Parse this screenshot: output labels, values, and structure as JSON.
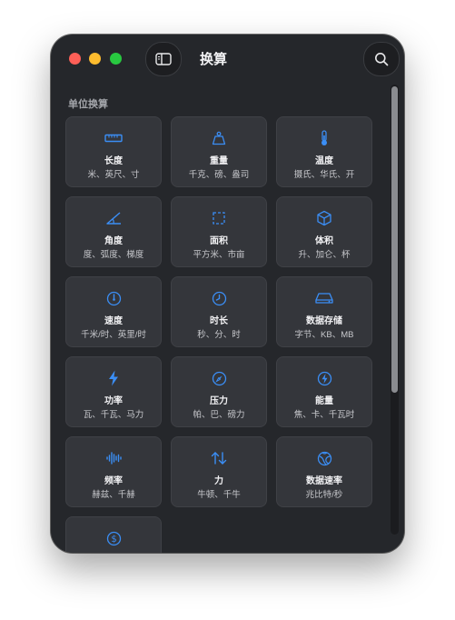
{
  "window": {
    "title": "换算",
    "section_label": "单位换算"
  },
  "units": [
    {
      "name": "长度",
      "examples": "米、英尺、寸",
      "icon": "ruler-icon"
    },
    {
      "name": "重量",
      "examples": "千克、磅、盎司",
      "icon": "weight-icon"
    },
    {
      "name": "温度",
      "examples": "摄氏、华氏、开",
      "icon": "thermometer-icon"
    },
    {
      "name": "角度",
      "examples": "度、弧度、梯度",
      "icon": "angle-icon"
    },
    {
      "name": "面积",
      "examples": "平方米、市亩",
      "icon": "area-icon"
    },
    {
      "name": "体积",
      "examples": "升、加仑、杯",
      "icon": "cube-icon"
    },
    {
      "name": "速度",
      "examples": "千米/时、英里/时",
      "icon": "speedometer-icon"
    },
    {
      "name": "时长",
      "examples": "秒、分、时",
      "icon": "clock-icon"
    },
    {
      "name": "数据存储",
      "examples": "字节、KB、MB",
      "icon": "storage-icon"
    },
    {
      "name": "功率",
      "examples": "瓦、千瓦、马力",
      "icon": "bolt-icon"
    },
    {
      "name": "压力",
      "examples": "帕、巴、磅力",
      "icon": "gauge-icon"
    },
    {
      "name": "能量",
      "examples": "焦、卡、千瓦时",
      "icon": "energy-icon"
    },
    {
      "name": "频率",
      "examples": "赫兹、千赫",
      "icon": "waveform-icon"
    },
    {
      "name": "力",
      "examples": "牛顿、千牛",
      "icon": "arrows-icon"
    },
    {
      "name": "数据速率",
      "examples": "兆比特/秒",
      "icon": "network-icon"
    },
    {
      "name": "",
      "examples": "",
      "icon": "currency-icon"
    }
  ],
  "colors": {
    "accent": "#3b8ef5",
    "window_bg": "#25272b",
    "card_bg": "#34363b"
  }
}
